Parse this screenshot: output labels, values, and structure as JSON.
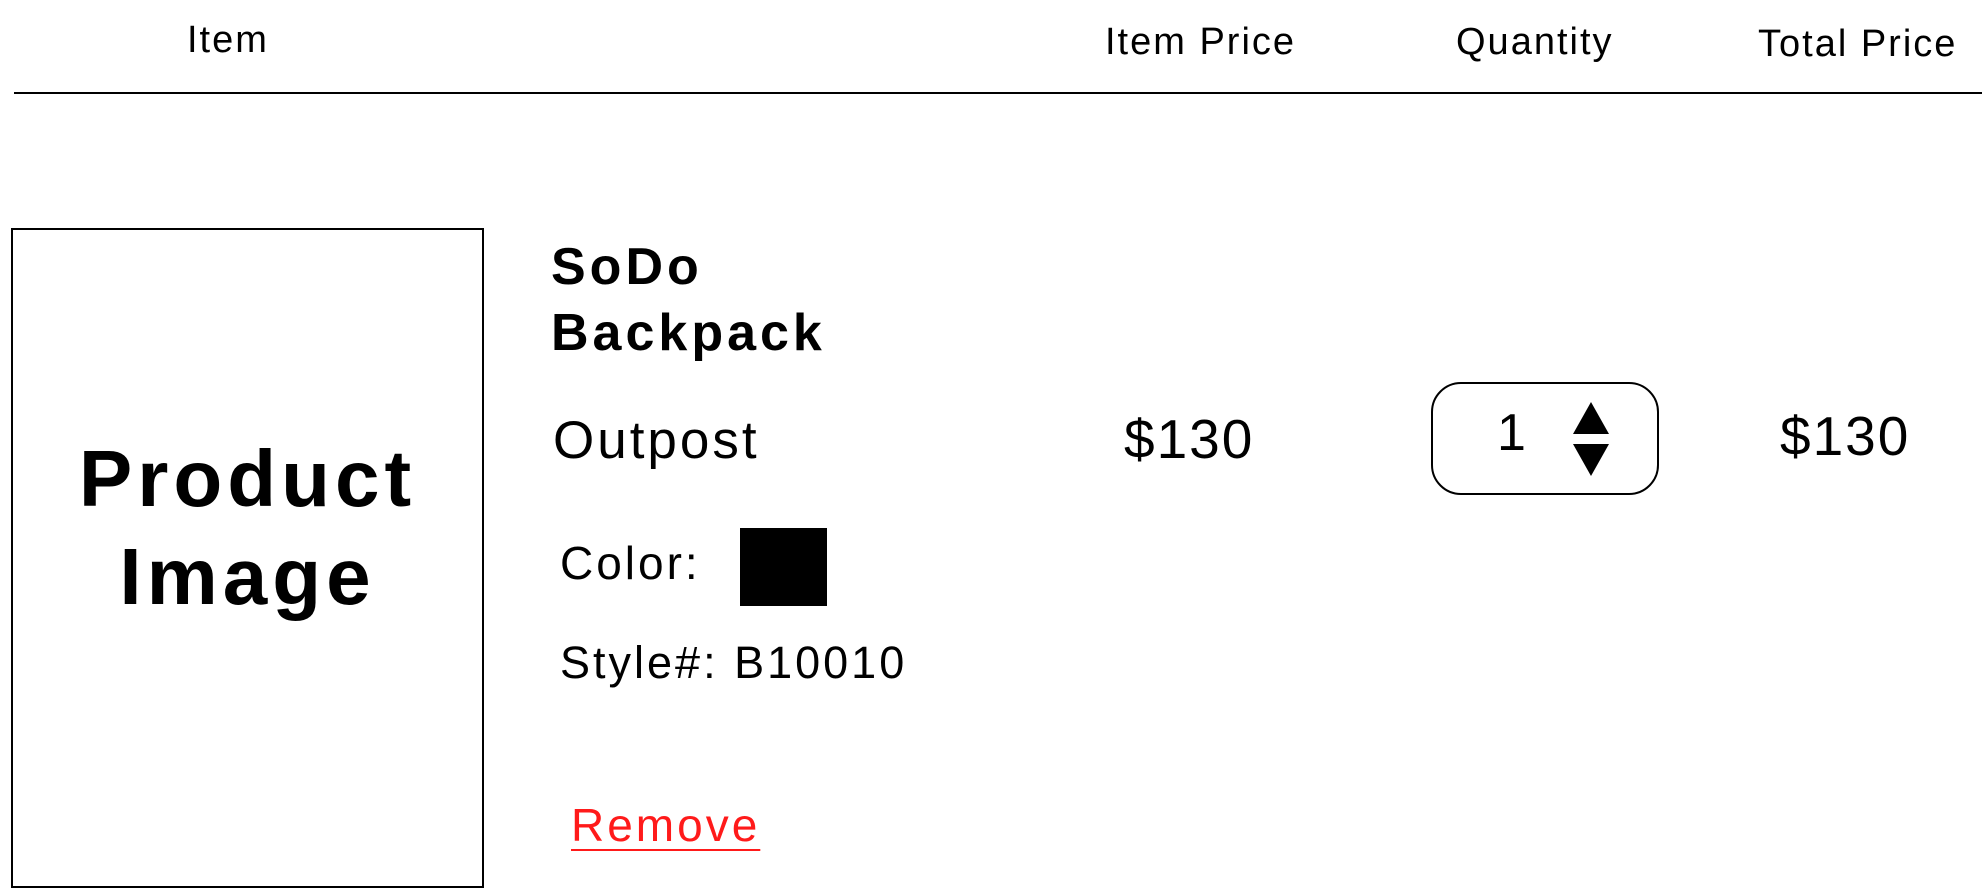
{
  "header": {
    "item": "Item",
    "item_price": "Item Price",
    "quantity": "Quantity",
    "total_price": "Total Price"
  },
  "cart_item": {
    "image_placeholder": "Product Image",
    "name": "SoDo Backpack",
    "brand": "Outpost",
    "color_label": "Color:",
    "color_value": "#000000",
    "style_label": "Style#: B10010",
    "remove_label": "Remove",
    "item_price": "$130",
    "quantity": "1",
    "total_price": "$130"
  },
  "icons": {
    "qty_up": "triangle-up-icon",
    "qty_down": "triangle-down-icon"
  },
  "colors": {
    "remove_link": "#ff1a1a",
    "text": "#000000",
    "background": "#ffffff"
  }
}
